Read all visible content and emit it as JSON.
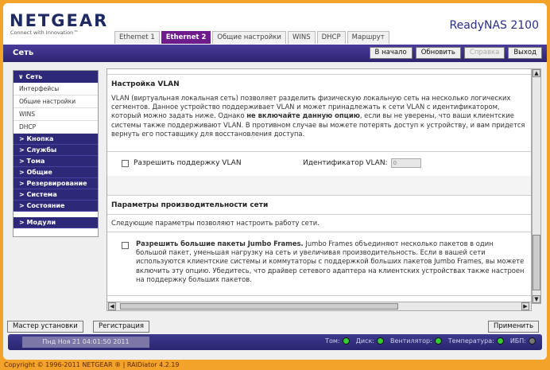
{
  "header": {
    "logo": "NETGEAR",
    "logo_tag": "Connect with Innovation™",
    "product": "ReadyNAS 2100"
  },
  "tabs": [
    "Ethernet 1",
    "Ethernet 2",
    "Общие настройки",
    "WINS",
    "DHCP",
    "Маршрут"
  ],
  "active_tab": "Ethernet 2",
  "navbar": {
    "title": "Сеть",
    "buttons": {
      "home": "В начало",
      "refresh": "Обновить",
      "help": "Справка",
      "logout": "Выход"
    }
  },
  "sidebar": {
    "network": "∨ Сеть",
    "sub_items": [
      "Интерфейсы",
      "Общие настройки",
      "WINS",
      "DHCP"
    ],
    "categories": [
      "Кнопка",
      "Службы",
      "Тома",
      "Общие",
      "Резервирование",
      "Система",
      "Состояние"
    ],
    "modules": "Модули"
  },
  "vlan": {
    "title": "Настройка VLAN",
    "desc_part1": "VLAN (виртуальная локальная сеть) позволяет разделить физическую локальную сеть на несколько логических сегментов. Данное устройство поддерживает VLAN и может принадлежать к сети VLAN с идентификатором, который можно задать ниже. Однако ",
    "desc_bold": "не включайте данную опцию",
    "desc_part2": ", если вы не уверены, что ваши клиентские системы также поддерживают VLAN. В противном случае вы можете потерять доступ к устройству, и вам придется вернуть его поставщику для восстановления доступа.",
    "checkbox_label": "Разрешить поддержку VLAN",
    "id_label": "Идентификатор VLAN:",
    "id_value": "0"
  },
  "perf": {
    "title": "Параметры производительности сети",
    "desc": "Следующие параметры позволяют настроить работу сети.",
    "jumbo_bold": "Разрешить большие пакеты Jumbo Frames.",
    "jumbo_text": " Jumbo Frames объединяют несколько пакетов в один большой пакет, уменьшая нагрузку на сеть и увеличивая производительность. Если в вашей сети используются клиентские системы и коммутаторы с поддержкой больших пакетов Jumbo Frames, вы можете включить эту опцию. Убедитесь, что драйвер сетевого адаптера на клиентских устройствах также настроен на поддержку больших пакетов."
  },
  "footer": {
    "wizard": "Мастер установки",
    "register": "Регистрация",
    "apply": "Применить",
    "datetime": "Пнд Ноя 21  04:01:50 2011",
    "status": [
      {
        "label": "Том:",
        "color": "#33cc33"
      },
      {
        "label": "Диск:",
        "color": "#33cc33"
      },
      {
        "label": "Вентилятор:",
        "color": "#33cc33"
      },
      {
        "label": "Температура:",
        "color": "#33cc33"
      },
      {
        "label": "ИБП:",
        "color": "#777777"
      }
    ]
  },
  "copyright": "Copyright © 1996-2011 NETGEAR ® | RAIDiator 4.2.19"
}
